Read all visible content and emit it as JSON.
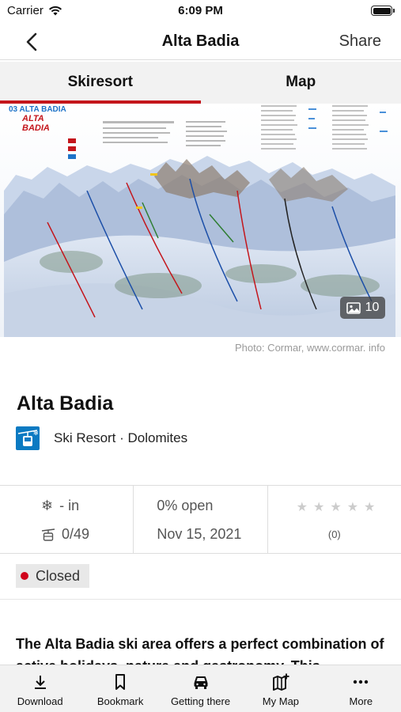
{
  "status_bar": {
    "carrier": "Carrier",
    "time": "6:09 PM"
  },
  "nav": {
    "title": "Alta Badia",
    "share_label": "Share"
  },
  "tabs": [
    {
      "label": "Skiresort",
      "active": true
    },
    {
      "label": "Map",
      "active": false
    }
  ],
  "hero": {
    "map_label": "03 ALTA BADIA",
    "logo_text": [
      "ALTA",
      "BADIA"
    ],
    "gallery_count": "10",
    "photo_credit": "Photo: Cormar, www.cormar. info"
  },
  "resort": {
    "name": "Alta Badia",
    "type_line": "Ski Resort · Dolomites"
  },
  "stats": {
    "snow": "- in",
    "lifts": "0/49",
    "open": "0% open",
    "date": "Nov 15, 2021",
    "rating_count": "(0)",
    "stars_filled": 0,
    "stars_total": 5
  },
  "status": {
    "label": "Closed",
    "color": "#d0021b"
  },
  "description": "The Alta Badia ski area offers a perfect combination of active holidays, nature and gastronomy. This",
  "bottom_bar": [
    {
      "label": "Download",
      "icon": "download-icon"
    },
    {
      "label": "Bookmark",
      "icon": "bookmark-icon"
    },
    {
      "label": "Getting there",
      "icon": "car-icon"
    },
    {
      "label": "My Map",
      "icon": "map-add-icon"
    },
    {
      "label": "More",
      "icon": "more-icon"
    }
  ],
  "colors": {
    "accent": "#c4161c",
    "resort_icon": "#0b7ac2"
  }
}
